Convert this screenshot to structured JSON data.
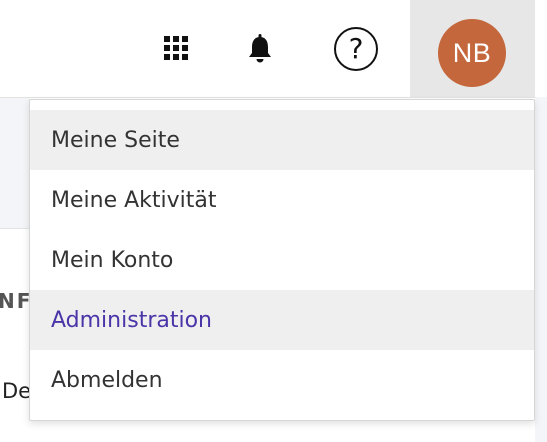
{
  "header": {
    "apps_icon": "grid-icon",
    "notifications_icon": "bell-icon",
    "help": {
      "icon": "question-circle-icon",
      "glyph": "?"
    },
    "user": {
      "initials": "NB",
      "avatar_color": "#c4673c"
    }
  },
  "background": {
    "heading_fragment": "NF",
    "text_fragment": "De"
  },
  "user_menu": {
    "items": [
      {
        "label": "Meine Seite"
      },
      {
        "label": "Meine Aktivität"
      },
      {
        "label": "Mein Konto"
      },
      {
        "label": "Administration",
        "color": "#4b34a8"
      },
      {
        "label": "Abmelden"
      }
    ]
  },
  "colors": {
    "accent": "#4b34a8",
    "highlight": "#efefef",
    "avatar_bg": "#c4673c"
  }
}
